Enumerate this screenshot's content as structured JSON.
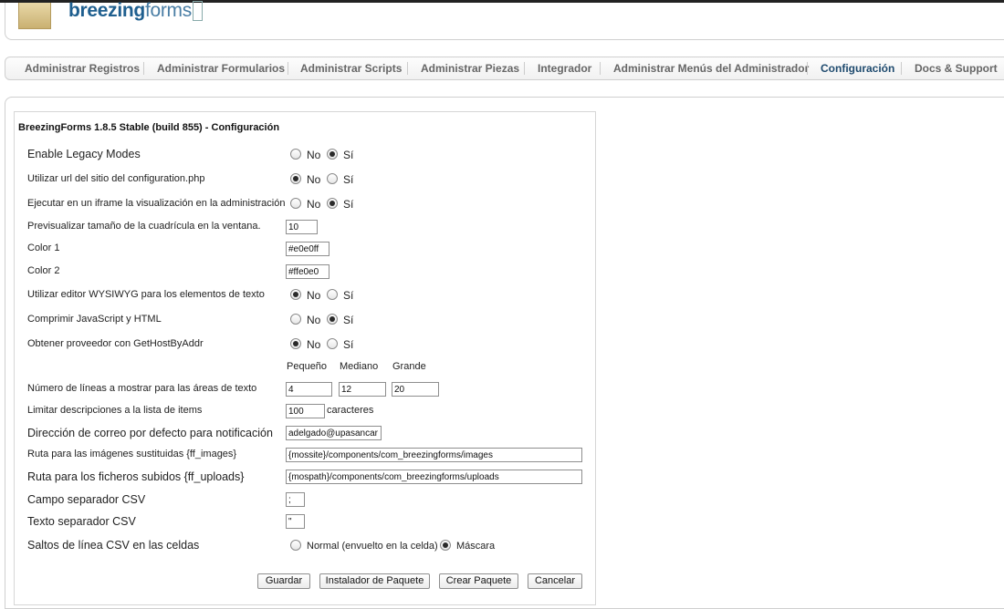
{
  "header": {
    "logo_bold": "breezing",
    "logo_light": "forms"
  },
  "nav": {
    "items": [
      "Administrar Registros",
      "Administrar Formularios",
      "Administrar Scripts",
      "Administrar Piezas",
      "Integrador",
      "Administrar Menús del Administrador",
      "Configuración",
      "Docs & Support"
    ],
    "active": "Configuración"
  },
  "form": {
    "title": "BreezingForms 1.8.5 Stable (build 855) - Configuración",
    "no_label": "No",
    "si_label": "Sí",
    "rows": {
      "legacy": {
        "label": "Enable Legacy Modes",
        "value": "Sí"
      },
      "site_url": {
        "label": "Utilizar url del sitio del configuration.php",
        "value": "No"
      },
      "iframe": {
        "label": "Ejecutar en un iframe la visualización en la administración",
        "value": "Sí"
      },
      "grid_size": {
        "label": "Previsualizar tamaño de la cuadrícula en la ventana.",
        "value": "10"
      },
      "color1": {
        "label": "Color 1",
        "value": "#e0e0ff"
      },
      "color2": {
        "label": "Color 2",
        "value": "#ffe0e0"
      },
      "wysiwyg": {
        "label": "Utilizar editor WYSIWYG para los elementos de texto",
        "value": "No"
      },
      "compress": {
        "label": "Comprimir JavaScript y HTML",
        "value": "Sí"
      },
      "hostbyaddr": {
        "label": "Obtener proveedor con GetHostByAddr",
        "value": "No"
      },
      "textarea_lines": {
        "label": "Número de líneas a mostrar para las áreas de texto",
        "headers": [
          "Pequeño",
          "Mediano",
          "Grande"
        ],
        "values": [
          "4",
          "12",
          "20"
        ]
      },
      "limit_desc": {
        "label": "Limitar descripciones a la lista de items",
        "value": "100",
        "suffix": "caracteres"
      },
      "mail": {
        "label": "Dirección de correo por defecto para notificación",
        "value": "adelgado@upasancar"
      },
      "images_path": {
        "label": "Ruta para las imágenes sustituidas {ff_images}",
        "value": "{mossite}/components/com_breezingforms/images"
      },
      "uploads_path": {
        "label": "Ruta para los ficheros subidos {ff_uploads}",
        "value": "{mospath}/components/com_breezingforms/uploads"
      },
      "csv_sep": {
        "label": "Campo separador CSV",
        "value": ";"
      },
      "csv_text": {
        "label": "Texto separador CSV",
        "value": "\""
      },
      "csv_newlines": {
        "label": "Saltos de línea CSV en las celdas",
        "opt1": "Normal (envuelto en la celda)",
        "opt2": "Máscara",
        "value": "Máscara"
      }
    },
    "buttons": {
      "save": "Guardar",
      "installer": "Instalador de Paquete",
      "create": "Crear Paquete",
      "cancel": "Cancelar"
    }
  }
}
